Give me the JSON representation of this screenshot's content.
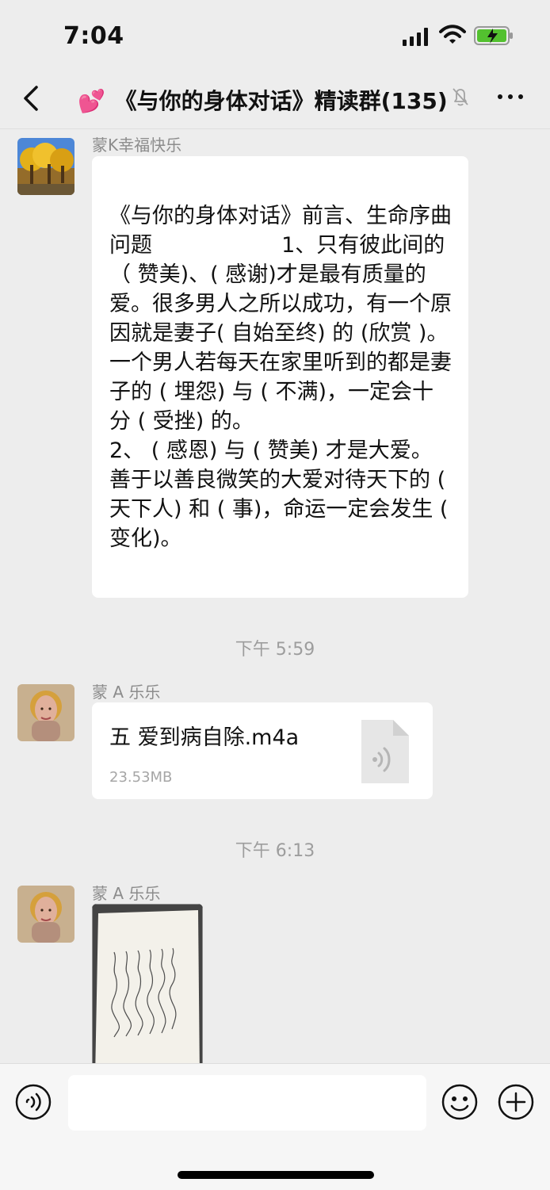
{
  "status_bar": {
    "time": "7:04",
    "icons": [
      "signal-icon",
      "wifi-icon",
      "battery-charging-icon"
    ]
  },
  "header": {
    "emoji": "💕",
    "title": "《与你的身体对话》精读群(135)",
    "left_icon": "back-chevron-icon",
    "mute_icon": "mute-bell-icon",
    "right_icon": "more-options-icon"
  },
  "messages": [
    {
      "sender": "蒙K幸福快乐",
      "type": "text",
      "text": "《与你的身体对话》前言、生命序曲 问题                   1、只有彼此间的（ 赞美)、( 感谢)才是最有质量的爱。很多男人之所以成功，有一个原因就是妻子( 自始至终) 的 (欣赏 )。一个男人若每天在家里听到的都是妻子的 ( 埋怨) 与 ( 不满)，一定会十分 ( 受挫) 的。\n2、 ( 感恩) 与 ( 赞美) 才是大爱。善于以善良微笑的大爱对待天下的 ( 天下人) 和 ( 事)，命运一定会发生 ( 变化)。"
    },
    {
      "type": "timestamp",
      "text": "下午 5:59"
    },
    {
      "sender": "蒙 A 乐乐",
      "type": "file",
      "file_name": "五  爱到病自除.m4a",
      "file_size": "23.53MB",
      "icon": "audio-file-icon"
    },
    {
      "type": "timestamp",
      "text": "下午 6:13"
    },
    {
      "sender": "蒙 A 乐乐",
      "type": "image",
      "description_icon": "handwritten-note-image"
    }
  ],
  "input_bar": {
    "left_icon": "voice-input-icon",
    "placeholder": "",
    "emoji_icon": "emoji-icon",
    "add_icon": "add-icon"
  },
  "colors": {
    "background": "#ededed",
    "bubble": "#ffffff",
    "timestamp": "#9d9d9d",
    "sender_name": "#8c8c8c"
  }
}
